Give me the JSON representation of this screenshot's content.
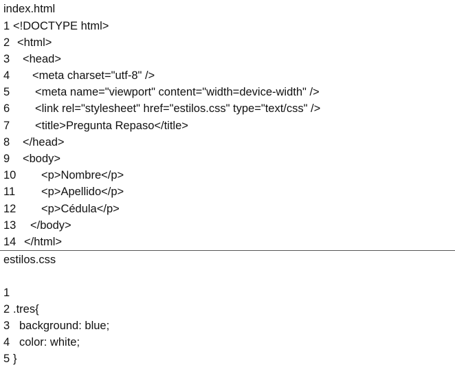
{
  "files": [
    {
      "name": "index.html",
      "lines": [
        {
          "num": "1",
          "text": "<!DOCTYPE html>"
        },
        {
          "num": "2",
          "text": "<html>"
        },
        {
          "num": "3",
          "text": "<head>"
        },
        {
          "num": "4",
          "text": "<meta charset=\"utf-8\" />"
        },
        {
          "num": "5",
          "text": "<meta name=\"viewport\" content=\"width=device-width\" />"
        },
        {
          "num": "6",
          "text": "<link rel=\"stylesheet\" href=\"estilos.css\" type=\"text/css\" />"
        },
        {
          "num": "7",
          "text": "<title>Pregunta Repaso</title>"
        },
        {
          "num": "8",
          "text": "</head>"
        },
        {
          "num": "9",
          "text": "<body>"
        },
        {
          "num": "10",
          "text": "<p>Nombre</p>"
        },
        {
          "num": "11",
          "text": "<p>Apellido</p>"
        },
        {
          "num": "12",
          "text": "<p>Cédula</p>"
        },
        {
          "num": "13",
          "text": "</body>"
        },
        {
          "num": "14",
          "text": "</html>"
        }
      ]
    },
    {
      "name": "estilos.css",
      "lines": [
        {
          "num": "1",
          "text": ""
        },
        {
          "num": "2",
          "text": ".tres{"
        },
        {
          "num": "3",
          "text": "background: blue;"
        },
        {
          "num": "4",
          "text": "color: white;"
        },
        {
          "num": "5",
          "text": "}"
        }
      ]
    }
  ]
}
